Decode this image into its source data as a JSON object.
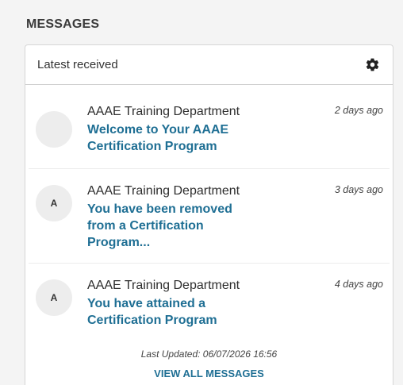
{
  "section": {
    "title": "MESSAGES"
  },
  "panel": {
    "header_label": "Latest received",
    "settings_icon": "gear-icon"
  },
  "messages": [
    {
      "avatar_initial": "",
      "sender": "AAAE Training Department",
      "subject": "Welcome to Your AAAE Certification Program",
      "time": "2 days ago"
    },
    {
      "avatar_initial": "A",
      "sender": "AAAE Training Department",
      "subject": "You have been removed from a Certification Program...",
      "time": "3 days ago"
    },
    {
      "avatar_initial": "A",
      "sender": "AAAE Training Department",
      "subject": "You have attained a Certification Program",
      "time": "4 days ago"
    }
  ],
  "footer": {
    "last_updated": "Last Updated: 06/07/2026 16:56",
    "view_all_label": "VIEW ALL MESSAGES"
  },
  "colors": {
    "link": "#1f6f94",
    "background": "#f4f4f4",
    "avatar_bg": "#ededed"
  }
}
